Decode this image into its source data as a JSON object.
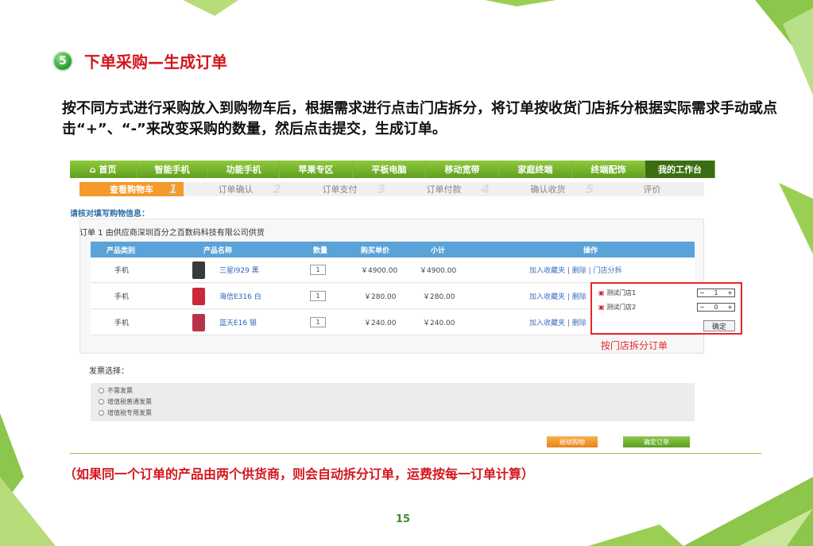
{
  "badge": "5",
  "title": "下单采购—生成订单",
  "paragraph": "按不同方式进行采购放入到购物车后，根据需求进行点击门店拆分，将订单按收货门店拆分根据实际需求手动或点击“+”、“-”来改变采购的数量，然后点击提交，生成订单。",
  "nav": [
    "首页",
    "智能手机",
    "功能手机",
    "苹果专区",
    "平板电脑",
    "移动宽带",
    "家庭终端",
    "终端配饰",
    "我的工作台"
  ],
  "steps": [
    {
      "label": "查看购物车",
      "num": "1"
    },
    {
      "label": "订单确认",
      "num": "2"
    },
    {
      "label": "订单支付",
      "num": "3"
    },
    {
      "label": "订单付款",
      "num": "4"
    },
    {
      "label": "确认收货",
      "num": "5"
    },
    {
      "label": "评价",
      "num": ""
    }
  ],
  "check_label": "请核对填写购物信息：",
  "order_title": "订单 1  由供应商深圳百分之百数码科技有限公司供货",
  "headers": {
    "category": "产品类别",
    "name": "产品名称",
    "qty": "数量",
    "price": "购买单价",
    "subtotal": "小计",
    "ops": "操作"
  },
  "rows": [
    {
      "category": "手机",
      "name": "三星I929 黑",
      "qty": "1",
      "price": "￥4900.00",
      "subtotal": "￥4900.00",
      "ops": "加入收藏夹 | 删除 | 门店分拆",
      "color": "#3a3a3a"
    },
    {
      "category": "手机",
      "name": "海信E316 白",
      "qty": "1",
      "price": "￥280.00",
      "subtotal": "￥280.00",
      "ops": "加入收藏夹 | 删除",
      "color": "#c8283a"
    },
    {
      "category": "手机",
      "name": "蓝天E16 银",
      "qty": "1",
      "price": "￥240.00",
      "subtotal": "￥240.00",
      "ops": "加入收藏夹 | 删除",
      "color": "#b8334a"
    }
  ],
  "popup": {
    "store1": "测试门店1",
    "qty1": "1",
    "store2": "测试门店2",
    "qty2": "0",
    "confirm": "确定",
    "minus": "−",
    "plus": "+"
  },
  "split_note": "按门店拆分订单",
  "invoice": {
    "label": "发票选择：",
    "options": [
      "不需发票",
      "增值税普通发票",
      "增值税专用发票"
    ]
  },
  "buttons": {
    "continue": "继续购物",
    "confirm_order": "确定订单"
  },
  "footer_note": "（如果同一个订单的产品由两个供货商，则会自动拆分订单，运费按每一订单计算）",
  "page_number": "15",
  "colors": {
    "accent_red": "#d4161c",
    "nav_green": "#6aa92a",
    "step_orange": "#f39a2a",
    "table_blue": "#5aa3d8"
  }
}
